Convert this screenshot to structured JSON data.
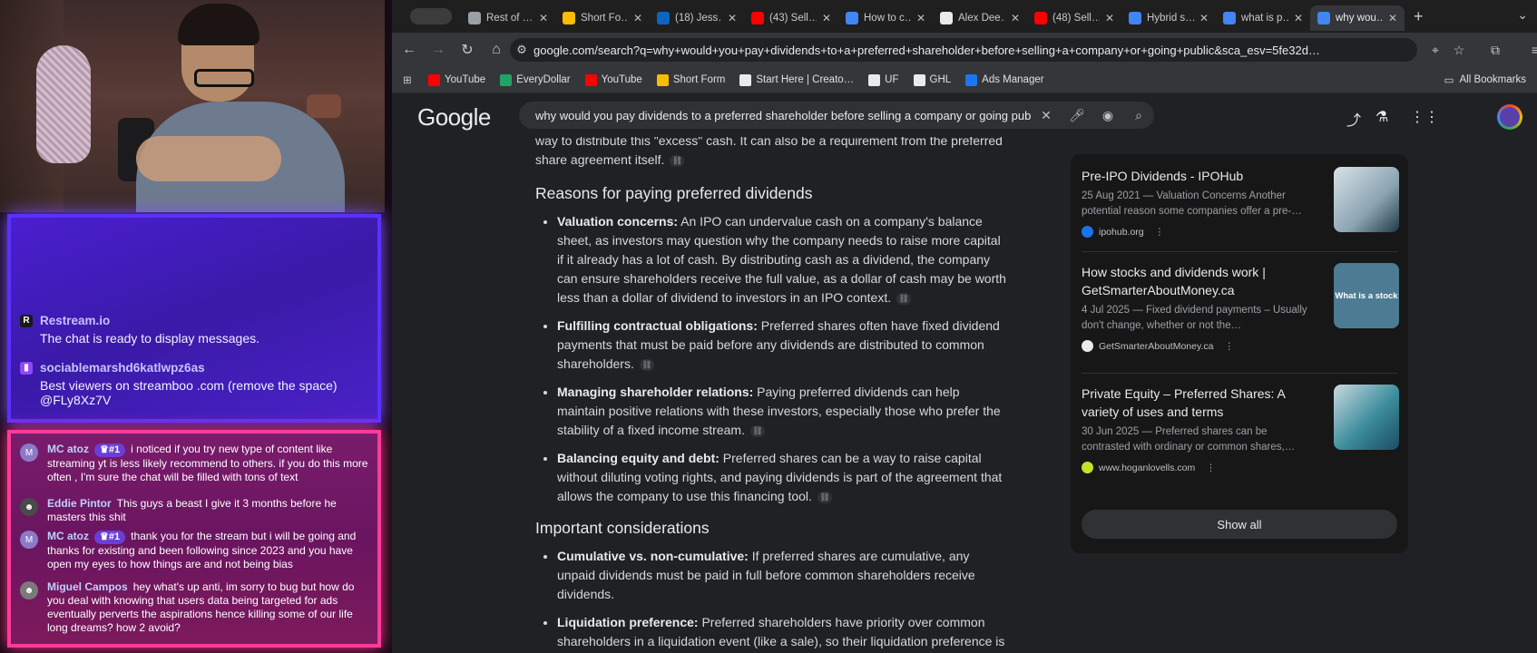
{
  "stream": {
    "restream": {
      "sender": "Restream.io",
      "message": "The chat is ready to display messages."
    },
    "twitch_msg": {
      "sender": "sociablemarshd6katlwpz6as",
      "message": "Best viewers on streamboo .com (remove the space) @FLy8Xz7V"
    },
    "chat": [
      {
        "avatar": "M",
        "user": "MC atoz",
        "badge": "#1",
        "text": "i noticed if you try new type of content like streaming yt is less likely recommend to others. if you do this more often , I'm sure the chat will be filled with tons of text"
      },
      {
        "avatar": "",
        "user": "Eddie Pintor",
        "badge": "",
        "text": "This guys a beast I give it 3 months before he masters this shit"
      },
      {
        "avatar": "M",
        "user": "MC atoz",
        "badge": "#1",
        "text": "thank you for the stream but i will be going and thanks for existing and been following since 2023 and you have open my eyes to how things are and not being bias"
      },
      {
        "avatar": "",
        "user": "Miguel Campos",
        "badge": "",
        "text": "hey what's up anti, im sorry to bug but how do you deal with knowing that users data being targeted for ads eventually perverts the aspirations hence killing some of our life long dreams? how 2 avoid?"
      }
    ]
  },
  "browser": {
    "tabs": [
      {
        "title": "Rest of …",
        "icon": "globe-icon",
        "color": "#9aa0a6"
      },
      {
        "title": "Short Fo…",
        "icon": "drive-icon",
        "color": "#fbbc04"
      },
      {
        "title": "(18) Jess…",
        "icon": "linkedin-icon",
        "color": "#0a66c2"
      },
      {
        "title": "(43) Sell…",
        "icon": "youtube-icon",
        "color": "#ff0000"
      },
      {
        "title": "How to c…",
        "icon": "docs-icon",
        "color": "#4285f4"
      },
      {
        "title": "Alex Dee…",
        "icon": "x-icon",
        "color": "#e8eaed"
      },
      {
        "title": "(48) Sell…",
        "icon": "youtube-icon",
        "color": "#ff0000"
      },
      {
        "title": "Hybrid s…",
        "icon": "google-icon",
        "color": "#4285f4"
      },
      {
        "title": "what is p…",
        "icon": "google-icon",
        "color": "#4285f4"
      },
      {
        "title": "why wou…",
        "icon": "google-icon",
        "color": "#4285f4",
        "active": true
      }
    ],
    "url": "google.com/search?q=why+would+you+pay+dividends+to+a+preferred+shareholder+before+selling+a+company+or+going+public&sca_esv=5fe32d…",
    "bookmarks": [
      {
        "label": "YouTube",
        "color": "#ff0000"
      },
      {
        "label": "EveryDollar",
        "color": "#21a366"
      },
      {
        "label": "YouTube",
        "color": "#ff0000"
      },
      {
        "label": "Short Form",
        "color": "#fbbc04"
      },
      {
        "label": "Start Here | Creato…",
        "color": "#e8eaed"
      },
      {
        "label": "UF",
        "color": "#e8eaed"
      },
      {
        "label": "GHL",
        "color": "#e8eaed"
      },
      {
        "label": "Ads Manager",
        "color": "#1877f2"
      }
    ],
    "all_bookmarks": "All Bookmarks"
  },
  "google": {
    "logo": "Google",
    "query": "why would you pay dividends to a preferred shareholder before selling a company or going public",
    "ai": {
      "intro": "way to distribute this \"excess\" cash. It can also be a requirement from the preferred share agreement itself.",
      "section1_title": "Reasons for paying preferred dividends",
      "section1": [
        {
          "term": "Valuation concerns:",
          "text": " An IPO can undervalue cash on a company's balance sheet, as investors may question why the company needs to raise more capital if it already has a lot of cash. By distributing cash as a dividend, the company can ensure shareholders receive the full value, as a dollar of cash may be worth less than a dollar of dividend to investors in an IPO context."
        },
        {
          "term": "Fulfilling contractual obligations:",
          "text": " Preferred shares often have fixed dividend payments that must be paid before any dividends are distributed to common shareholders."
        },
        {
          "term": "Managing shareholder relations:",
          "text": " Paying preferred dividends can help maintain positive relations with these investors, especially those who prefer the stability of a fixed income stream."
        },
        {
          "term": "Balancing equity and debt:",
          "text": " Preferred shares can be a way to raise capital without diluting voting rights, and paying dividends is part of the agreement that allows the company to use this financing tool."
        }
      ],
      "section2_title": "Important considerations",
      "section2": [
        {
          "term": "Cumulative vs. non-cumulative:",
          "text": " If preferred shares are cumulative, any unpaid dividends must be paid in full before common shareholders receive dividends."
        },
        {
          "term": "Liquidation preference:",
          "text": " Preferred shareholders have priority over common shareholders in a liquidation event (like a sale), so their liquidation preference is a"
        }
      ]
    },
    "sources": [
      {
        "title": "Pre-IPO Dividends - IPOHub",
        "snippet": "25 Aug 2021 — Valuation Concerns Another potential reason some companies offer a pre-…",
        "site": "ipohub.org"
      },
      {
        "title": "How stocks and dividends work | GetSmarterAboutMoney.ca",
        "snippet": "4 Jul 2025 — Fixed dividend payments – Usually don't change, whether or not the…",
        "site": "GetSmarterAboutMoney.ca",
        "thumb_text": "What is a stock"
      },
      {
        "title": "Private Equity – Preferred Shares: A variety of uses and terms",
        "snippet": "30 Jun 2025 — Preferred shares can be contrasted with ordinary or common shares,…",
        "site": "www.hoganlovells.com"
      }
    ],
    "show_all": "Show all"
  }
}
